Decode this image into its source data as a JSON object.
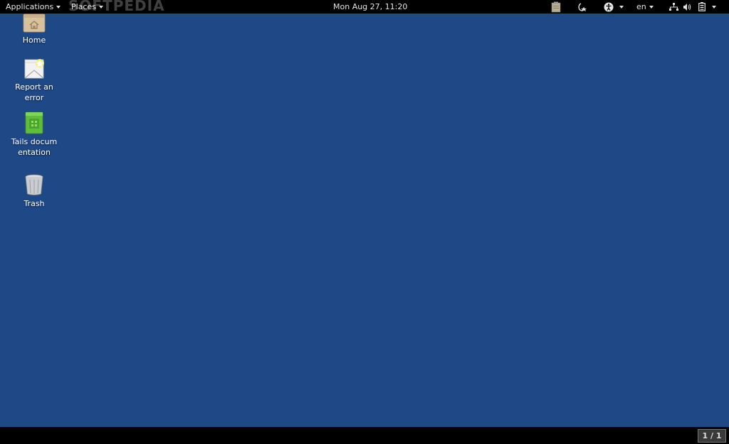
{
  "topbar": {
    "applications_label": "Applications",
    "places_label": "Places",
    "watermark": "SOFTPEDIA",
    "clock": "Mon Aug 27, 11:20",
    "tray": {
      "clipboard_icon": "clipboard-icon",
      "tor_icon": "onion-circuit-icon",
      "accessibility_icon": "accessibility-icon",
      "language": "en",
      "network_icon": "network-icon",
      "volume_icon": "volume-icon",
      "battery_icon": "battery-icon"
    }
  },
  "desktop": {
    "icons": [
      {
        "label": "Home",
        "icon": "home-folder-icon"
      },
      {
        "label": "Report an error",
        "icon": "report-error-icon"
      },
      {
        "label": "Tails documentation",
        "icon": "documentation-book-icon"
      },
      {
        "label": "Trash",
        "icon": "trash-icon"
      }
    ]
  },
  "bottombar": {
    "workspace_indicator": "1 / 1"
  }
}
